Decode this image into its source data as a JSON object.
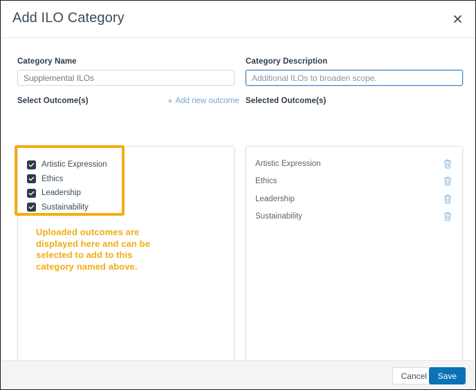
{
  "modal": {
    "title": "Add ILO Category",
    "close_icon": "close-icon"
  },
  "form": {
    "category_name": {
      "label": "Category Name",
      "value": "Supplemental ILOs",
      "placeholder": "Category Name"
    },
    "category_description": {
      "label": "Category Description",
      "value": "",
      "placeholder": "Additional ILOs to broaden scope.",
      "focused": true,
      "focus_border_color": "#3a86c8"
    }
  },
  "select_outcomes": {
    "label": "Select Outcome(s)",
    "add_link": {
      "label": "Add new outcome",
      "icon": "plus-icon",
      "color": "#6ea6d8"
    },
    "items": [
      {
        "label": "Artistic Expression",
        "checked": true
      },
      {
        "label": "Ethics",
        "checked": true
      },
      {
        "label": "Leadership",
        "checked": true
      },
      {
        "label": "Sustainability",
        "checked": true
      }
    ],
    "checkbox_color": "#2d3b4e"
  },
  "selected_outcomes": {
    "label": "Selected Outcome(s)",
    "delete_icon": "trash-icon",
    "delete_icon_color": "#8ab4d8",
    "items": [
      {
        "label": "Artistic Expression"
      },
      {
        "label": "Ethics"
      },
      {
        "label": "Leadership"
      },
      {
        "label": "Sustainability"
      }
    ]
  },
  "annotation": {
    "color": "#f2ad13",
    "text": "Uploaded outcomes are displayed here and can be selected to add to this category named above."
  },
  "footer": {
    "cancel_label": "Cancel",
    "save_label": "Save",
    "save_color": "#0b72b5"
  }
}
